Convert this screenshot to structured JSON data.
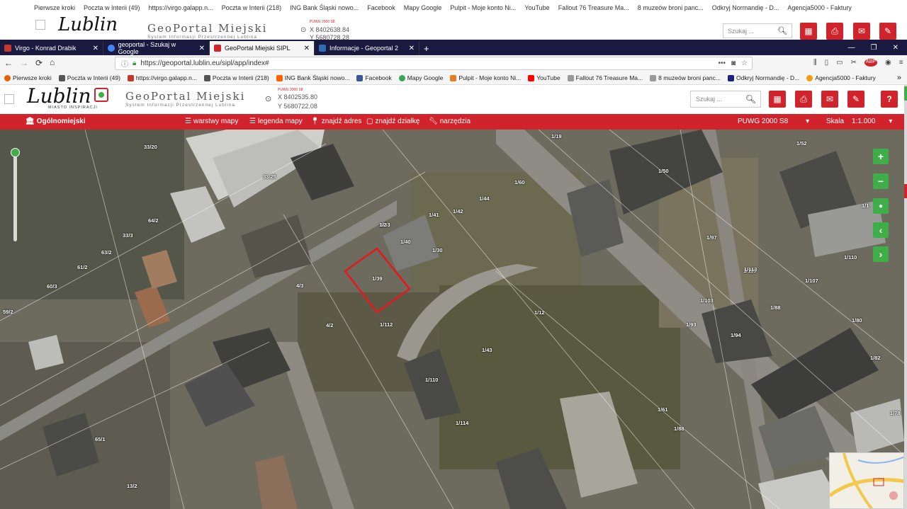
{
  "ghost": {
    "bookmarks": [
      "Pierwsze kroki",
      "Poczta w Interii (49)",
      "https://virgo.galapp.n...",
      "Poczta w Interii (218)",
      "ING Bank Śląski nowo...",
      "Facebook",
      "Mapy Google",
      "Pulpit - Moje konto Ni...",
      "YouTube",
      "Fallout 76 Treasure Ma...",
      "8 muzeów broni panc...",
      "Odkryj Normandię - D...",
      "Agencja5000 - Faktury"
    ],
    "logo": "Lublin",
    "title": "GeoPortal Miejski",
    "subtitle": "System Informacji Przestrzennej Lublina",
    "crs": "PUWG 2000 S8",
    "x": "X 8402638.84",
    "y": "Y 5680728.28",
    "search_placeholder": "Szukaj ..."
  },
  "tabs": [
    {
      "label": "Virgo - Konrad Drabik",
      "color": "#c0392b"
    },
    {
      "label": "geoportal - Szukaj w Google",
      "color": "#4285f4"
    },
    {
      "label": "GeoPortal Miejski SIPL",
      "color": "#d0232b",
      "active": true
    },
    {
      "label": "Informacje - Geoportal 2",
      "color": "#2e6db4"
    }
  ],
  "nav": {
    "url": "https://geoportal.lublin.eu/sipl/app/index#",
    "menu_dots": "•••"
  },
  "bookmarks": [
    {
      "label": "Pierwsze kroki",
      "color": "#e66000"
    },
    {
      "label": "Poczta w Interii (49)",
      "color": "#555"
    },
    {
      "label": "https://virgo.galapp.n...",
      "color": "#c0392b"
    },
    {
      "label": "Poczta w Interii (218)",
      "color": "#555"
    },
    {
      "label": "ING Bank Śląski nowo...",
      "color": "#ff6200"
    },
    {
      "label": "Facebook",
      "color": "#3b5998"
    },
    {
      "label": "Mapy Google",
      "color": "#34a853"
    },
    {
      "label": "Pulpit - Moje konto Ni...",
      "color": "#e67e22"
    },
    {
      "label": "YouTube",
      "color": "#ff0000"
    },
    {
      "label": "Fallout 76 Treasure Ma...",
      "color": "#999"
    },
    {
      "label": "8 muzeów broni panc...",
      "color": "#999"
    },
    {
      "label": "Odkryj Normandię - D...",
      "color": "#1a237e"
    },
    {
      "label": "Agencja5000 - Faktury",
      "color": "#f39c12"
    }
  ],
  "header": {
    "logo": "Lublin",
    "logo_tagline": "MIASTO INSPIRACJI",
    "title": "GeoPortal Miejski",
    "subtitle": "System Informacji Przestrzennej Lublina",
    "crs": "PUWG 2000 S8",
    "x": "X 8402535.80",
    "y": "Y 5680722.08",
    "search_placeholder": "Szukaj ..."
  },
  "menubar": {
    "home": "Ogólnomiejski",
    "layers": "warstwy mapy",
    "legend": "legenda mapy",
    "find_address": "znajdź adres",
    "find_parcel": "znajdź działkę",
    "tools": "narzędzia",
    "crs": "PUWG 2000 S8",
    "scale_label": "Skala",
    "scale_value": "1:1.000"
  },
  "parcels": [
    "33/20",
    "33/25",
    "64/2",
    "33/3",
    "63/2",
    "61/2",
    "60/3",
    "59/2",
    "1/41",
    "1/42",
    "1/44",
    "1/60",
    "1/40",
    "1/30",
    "1/39",
    "1/33",
    "4/3",
    "4/2",
    "1/112",
    "1/12",
    "1/43",
    "1/110",
    "1/114",
    "1/61",
    "1/88",
    "1/97",
    "1/103",
    "1/107",
    "1/115",
    "1/110",
    "1/93",
    "1/88",
    "1/94",
    "1/82",
    "1/80",
    "1/78",
    "1/50",
    "1/52",
    "1/1",
    "1/19",
    "65/1",
    "13/2",
    "1/2",
    "1/113"
  ],
  "map_controls": [
    "+",
    "−",
    "●",
    "‹",
    "›"
  ]
}
